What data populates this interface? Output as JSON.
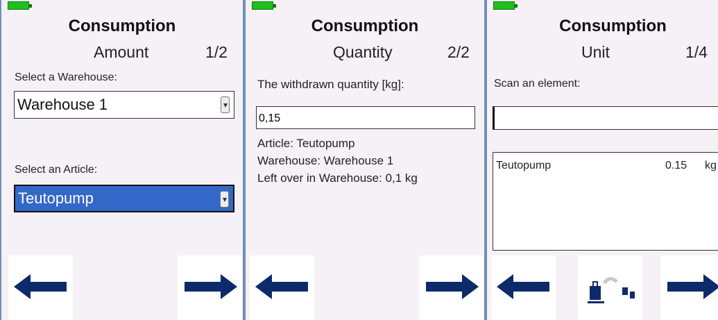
{
  "colors": {
    "panel_bg": "#f6f1f6",
    "border": "#6f8fb5",
    "battery": "#1fc01f",
    "selection": "#3468c8",
    "arrow": "#0d2b6b"
  },
  "panels": [
    {
      "title": "Consumption",
      "step_label": "Amount",
      "step_count": "1/2",
      "warehouse_label": "Select a Warehouse:",
      "warehouse_value": "Warehouse 1",
      "article_label": "Select an Article:",
      "article_value": "Teutopump"
    },
    {
      "title": "Consumption",
      "step_label": "Quantity",
      "step_count": "2/2",
      "quantity_label": "The withdrawn quantity [kg]:",
      "quantity_value": "0,15",
      "article_info": "Article: Teutopump",
      "warehouse_info": "Warehouse: Warehouse 1",
      "leftover_info": "Left over in Warehouse: 0,1 kg"
    },
    {
      "title": "Consumption",
      "step_label": "Unit",
      "step_count": "1/4",
      "scan_label": "Scan an element:",
      "scan_value": "",
      "list": [
        {
          "name": "Teutopump",
          "amount": "0.15",
          "unit": "kg"
        }
      ]
    }
  ],
  "icons": {
    "back": "arrow-left-icon",
    "next": "arrow-right-icon",
    "scale": "scale-bags-icon",
    "battery": "battery-icon"
  }
}
